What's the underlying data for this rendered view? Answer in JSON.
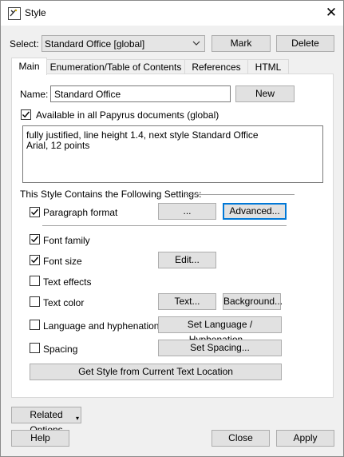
{
  "window": {
    "title": "Style",
    "close_glyph": "✕"
  },
  "select_row": {
    "label": "Select:",
    "value": "Standard Office [global]",
    "mark": "Mark",
    "delete": "Delete"
  },
  "tabs": [
    {
      "label": "Main",
      "active": true
    },
    {
      "label": "Enumeration/Table of Contents",
      "active": false
    },
    {
      "label": "References",
      "active": false
    },
    {
      "label": "HTML",
      "active": false
    }
  ],
  "main": {
    "name_label": "Name:",
    "name_value": "Standard Office",
    "new_button": "New",
    "available_label": "Available in all Papyrus documents (global)",
    "available_checked": true,
    "description_lines": [
      "fully justified, line height 1.4, next style Standard Office",
      "Arial, 12 points"
    ],
    "settings_header": "This Style Contains the Following Settings:",
    "settings": {
      "paragraph_format": {
        "label": "Paragraph format",
        "checked": true,
        "btn1": "...",
        "btn2": "Advanced..."
      },
      "font_family": {
        "label": "Font family",
        "checked": true
      },
      "font_size": {
        "label": "Font size",
        "checked": true,
        "btn1": "Edit..."
      },
      "text_effects": {
        "label": "Text effects",
        "checked": false
      },
      "text_color": {
        "label": "Text color",
        "checked": false,
        "btn1": "Text...",
        "btn2": "Background..."
      },
      "language": {
        "label": "Language and hyphenation",
        "checked": false,
        "btn1": "Set Language / Hyphenation..."
      },
      "spacing": {
        "label": "Spacing",
        "checked": false,
        "btn1": "Set Spacing..."
      }
    },
    "get_style_button": "Get Style from Current Text Location"
  },
  "footer": {
    "related_options": "Related Options",
    "help": "Help",
    "close": "Close",
    "apply": "Apply"
  }
}
